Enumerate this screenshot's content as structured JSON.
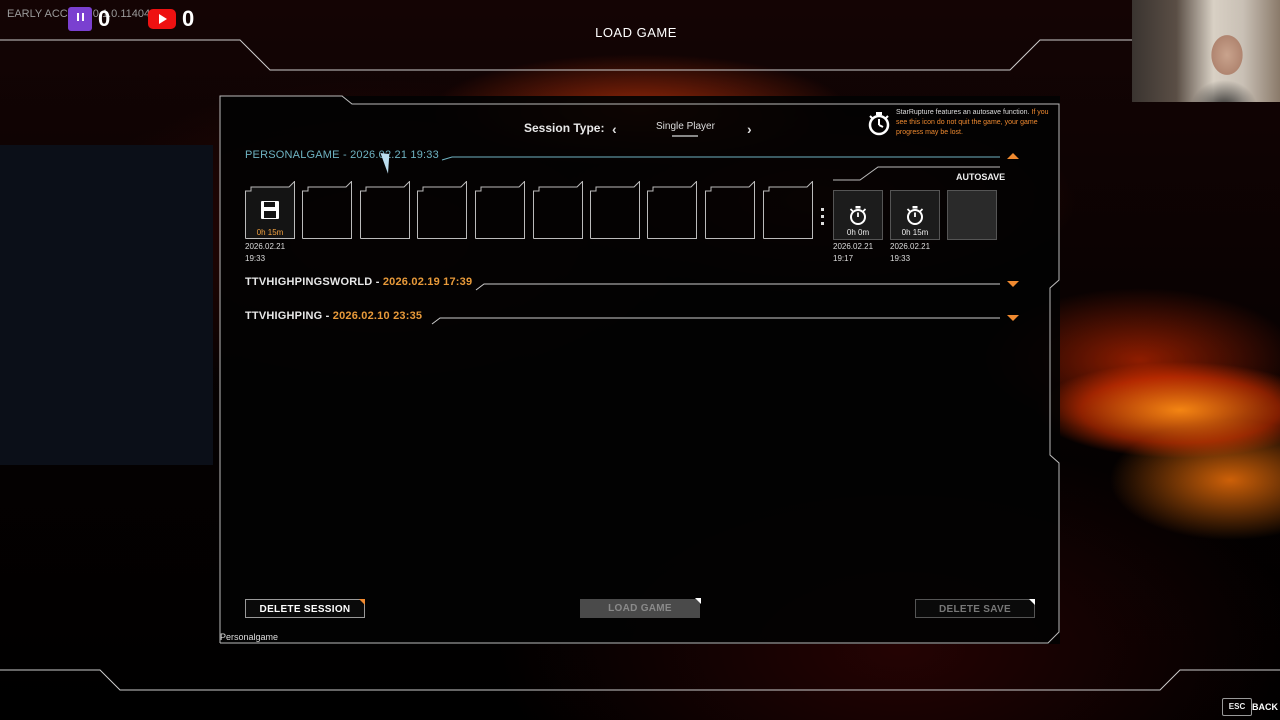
{
  "header": {
    "version_text": "EARLY ACCESS 0.1.0.11404",
    "twitch_count": "0",
    "youtube_count": "0",
    "title": "LOAD GAME"
  },
  "session_type": {
    "label": "Session Type:",
    "value": "Single Player",
    "prev_icon": "chevron-left-icon",
    "next_icon": "chevron-right-icon"
  },
  "autosave_info": {
    "icon": "stopwatch-icon",
    "text": "StarRupture features an autosave function.",
    "warning": "If you see this icon do not quit the game, your game progress may be lost."
  },
  "sessions": [
    {
      "name": "PERSONALGAME",
      "separator": " - ",
      "date": "2026.02.21 19:33",
      "expanded": true,
      "save_slots": [
        {
          "time": "0h 15m",
          "date": "2026.02.21",
          "clock": "19:33"
        }
      ],
      "autosave_label": "AUTOSAVE",
      "autosaves": [
        {
          "time": "0h 0m",
          "date": "2026.02.21",
          "clock": "19:17"
        },
        {
          "time": "0h 15m",
          "date": "2026.02.21",
          "clock": "19:33"
        }
      ]
    },
    {
      "name": "TTVHIGHPINGSWORLD",
      "separator": " - ",
      "date": "2026.02.19 17:39",
      "expanded": false
    },
    {
      "name": "TTVHIGHPING",
      "separator": " - ",
      "date": "2026.02.10 23:35",
      "expanded": false
    }
  ],
  "buttons": {
    "delete_session": "DELETE SESSION",
    "load_game": "LOAD GAME",
    "delete_save": "DELETE SAVE"
  },
  "footer": {
    "selected_session": "Personalgame",
    "esc_key": "ESC",
    "back_label": "BACK"
  },
  "colors": {
    "accent": "#f08a30",
    "active_session": "#6fb3c2"
  }
}
